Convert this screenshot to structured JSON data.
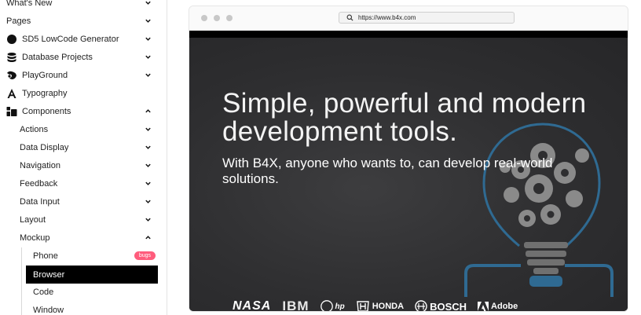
{
  "sidebar": {
    "items": [
      {
        "label": "What's New",
        "chevron": "down"
      },
      {
        "label": "Pages",
        "chevron": "down"
      },
      {
        "label": "SD5 LowCode Generator",
        "icon": "circle-icon",
        "chevron": "down"
      },
      {
        "label": "Database Projects",
        "icon": "database-icon",
        "chevron": "down"
      },
      {
        "label": "PlayGround",
        "icon": "playground-icon",
        "chevron": "down"
      },
      {
        "label": "Typography",
        "icon": "typography-icon"
      },
      {
        "label": "Components",
        "icon": "components-icon",
        "chevron": "up"
      }
    ],
    "components": [
      {
        "label": "Actions"
      },
      {
        "label": "Data Display"
      },
      {
        "label": "Navigation"
      },
      {
        "label": "Feedback"
      },
      {
        "label": "Data Input"
      },
      {
        "label": "Layout"
      },
      {
        "label": "Mockup"
      }
    ],
    "mockup": [
      {
        "label": "Phone",
        "badge": "bugs"
      },
      {
        "label": "Browser",
        "selected": true
      },
      {
        "label": "Code"
      },
      {
        "label": "Window"
      }
    ]
  },
  "browser": {
    "url": "https://www.b4x.com",
    "hero": {
      "title": "Simple, powerful and modern development tools.",
      "subtitle": "With B4X, anyone who wants to, can develop real-world solutions."
    },
    "logos": [
      "NASA",
      "IBM",
      "hp",
      "HONDA",
      "BOSCH",
      "Adobe"
    ]
  },
  "colors": {
    "selected_bg": "#000000",
    "badge_bg": "#ff5c7c",
    "hero_bg": "#2e2e30",
    "bulb_accent": "#2f6a92"
  }
}
